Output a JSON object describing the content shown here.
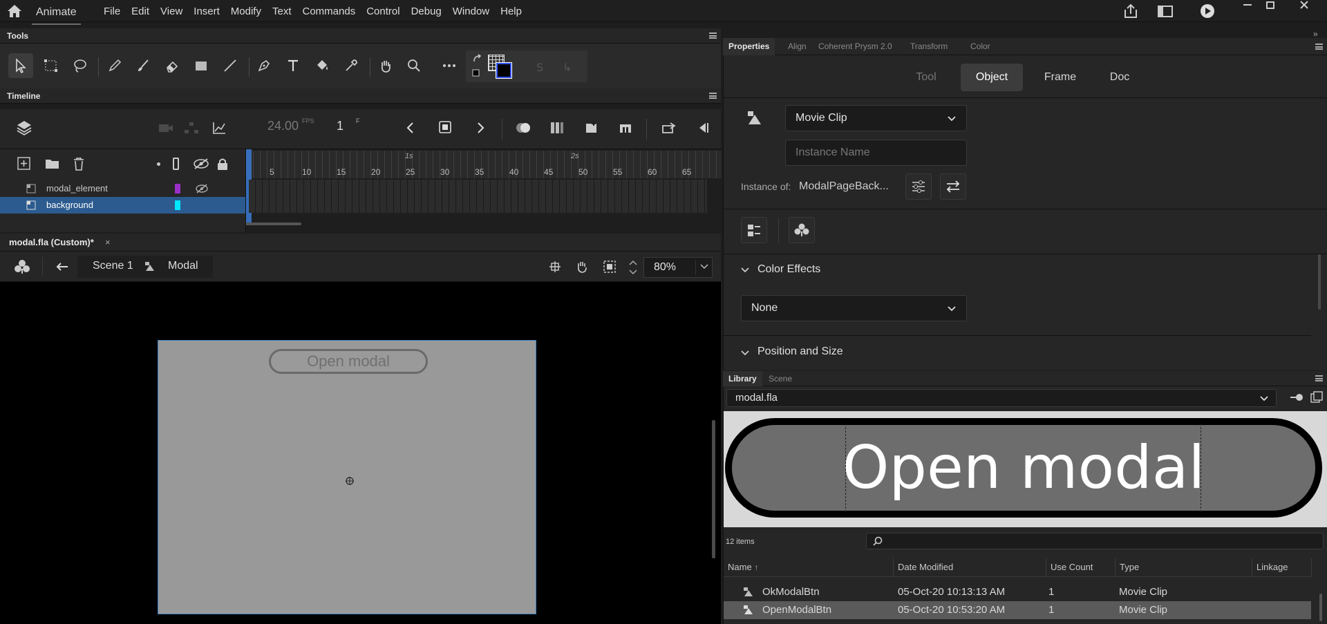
{
  "app": {
    "name": "Animate",
    "menus": [
      "File",
      "Edit",
      "View",
      "Insert",
      "Modify",
      "Text",
      "Commands",
      "Control",
      "Debug",
      "Window",
      "Help"
    ]
  },
  "tools_panel": {
    "title": "Tools"
  },
  "timeline": {
    "title": "Timeline",
    "fps": "24.00",
    "fps_unit": "FPS",
    "frame": "1",
    "frame_unit": "F",
    "ruler_seconds": [
      "1s",
      "2s"
    ],
    "ruler_frames": [
      "5",
      "10",
      "15",
      "20",
      "25",
      "30",
      "35",
      "40",
      "45",
      "50",
      "55",
      "60",
      "65"
    ],
    "layers": [
      {
        "name": "modal_element",
        "color": "#9b30c8",
        "selected": false
      },
      {
        "name": "background",
        "color": "#00e5ff",
        "selected": true
      }
    ]
  },
  "document": {
    "tab_title": "modal.fla (Custom)*",
    "scene": "Scene 1",
    "symbol": "Modal",
    "zoom": "80%",
    "stage_button_label": "Open modal"
  },
  "properties": {
    "tabs": [
      "Properties",
      "Align",
      "Coherent Prysm 2.0",
      "Transform",
      "Color"
    ],
    "segments": [
      "Tool",
      "Object",
      "Frame",
      "Doc"
    ],
    "active_segment": "Object",
    "symbol_type": "Movie Clip",
    "instance_name_placeholder": "Instance Name",
    "instance_of_label": "Instance of:",
    "instance_of_value": "ModalPageBack...",
    "color_effects_title": "Color Effects",
    "color_effect_value": "None",
    "position_size_title": "Position and Size"
  },
  "library": {
    "tabs": [
      "Library",
      "Scene"
    ],
    "document": "modal.fla",
    "preview_label": "Open modal",
    "item_count": "12 items",
    "columns": [
      "Name",
      "Date Modified",
      "Use Count",
      "Type",
      "Linkage"
    ],
    "items": [
      {
        "name": "OkModalBtn",
        "date": "05-Oct-20 10:13:13 AM",
        "count": "1",
        "type": "Movie Clip",
        "selected": false
      },
      {
        "name": "OpenModalBtn",
        "date": "05-Oct-20 10:53:20 AM",
        "count": "1",
        "type": "Movie Clip",
        "selected": true
      }
    ]
  }
}
